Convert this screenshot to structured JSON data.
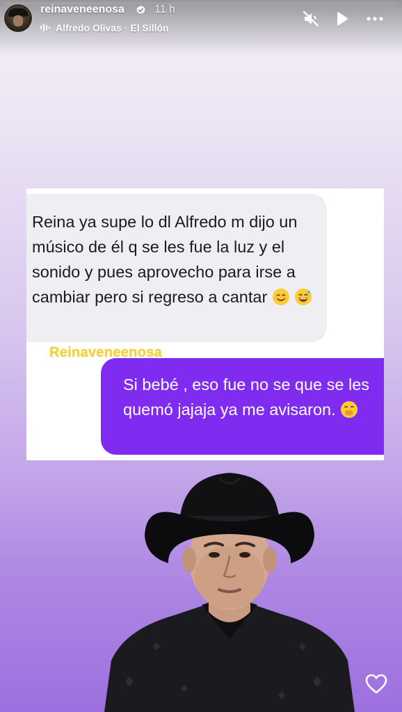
{
  "story": {
    "progress_fraction": 1.0,
    "username": "reinaveneenosa",
    "verified": true,
    "time_ago": "11 h",
    "music": "Alfredo Olivas · El Sillón",
    "icons": {
      "music": "music-bars-icon",
      "mute": "speaker-muted-icon",
      "play": "play-icon",
      "more": "more-horizontal-icon",
      "like": "heart-icon"
    }
  },
  "chat": {
    "received_message": "Reina ya supe lo dl Alfredo m dijo un músico de él q se les fue la luz y el sonido y pues aprovecho para irse a cambiar pero si regreso a cantar",
    "received_emojis": [
      "😊",
      "😅"
    ],
    "watermark": "Reinaveneenosa",
    "sent_message": "Si bebé , eso fue no se que se les quemó jajaja ya me avisaron.",
    "sent_emoji": "🤭",
    "colors": {
      "received_bubble": "#efeef2",
      "sent_bubble": "#7f2bf0",
      "watermark": "#f4d13e"
    }
  },
  "background": {
    "gradient_top": "#f4f1f7",
    "gradient_bottom": "#9d70df"
  }
}
